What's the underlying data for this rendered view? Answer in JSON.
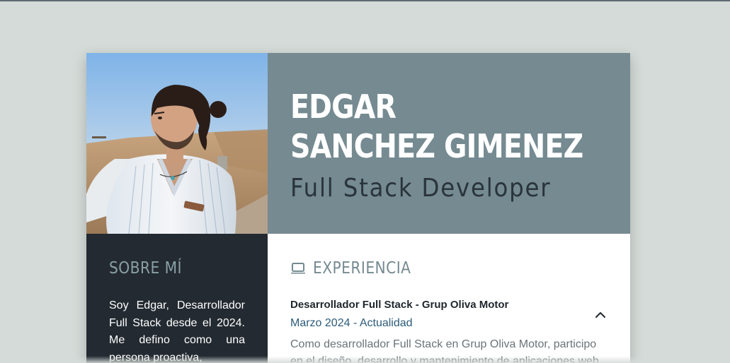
{
  "profile": {
    "name_line1": "EDGAR",
    "name_line2": "SANCHEZ GIMENEZ",
    "role": "Full Stack Developer",
    "photo_alt": "Edgar Sanchez Gimenez"
  },
  "sidebar": {
    "about_title": "SOBRE MÍ",
    "about_text": "Soy Edgar, Desarrollador Full Stack desde el 2024. Me defino como una persona proactiva,"
  },
  "experience": {
    "icon": "laptop-icon",
    "title": "EXPERIENCIA",
    "items": [
      {
        "title": "Desarrollador Full Stack - Grup Oliva Motor",
        "date": "Marzo 2024 - Actualidad",
        "description": "Como desarrollador Full Stack en Grup Oliva Motor, participo en el diseño, desarrollo y mantenimiento de aplicaciones web",
        "toggle_icon": "chevron-up-icon",
        "expanded": true
      }
    ]
  },
  "colors": {
    "page_background": "#d5dbd8",
    "header_background": "#758a91",
    "sidebar_background": "#232a31",
    "accent_text": "#758a91",
    "date_text": "#2c5b7a"
  }
}
